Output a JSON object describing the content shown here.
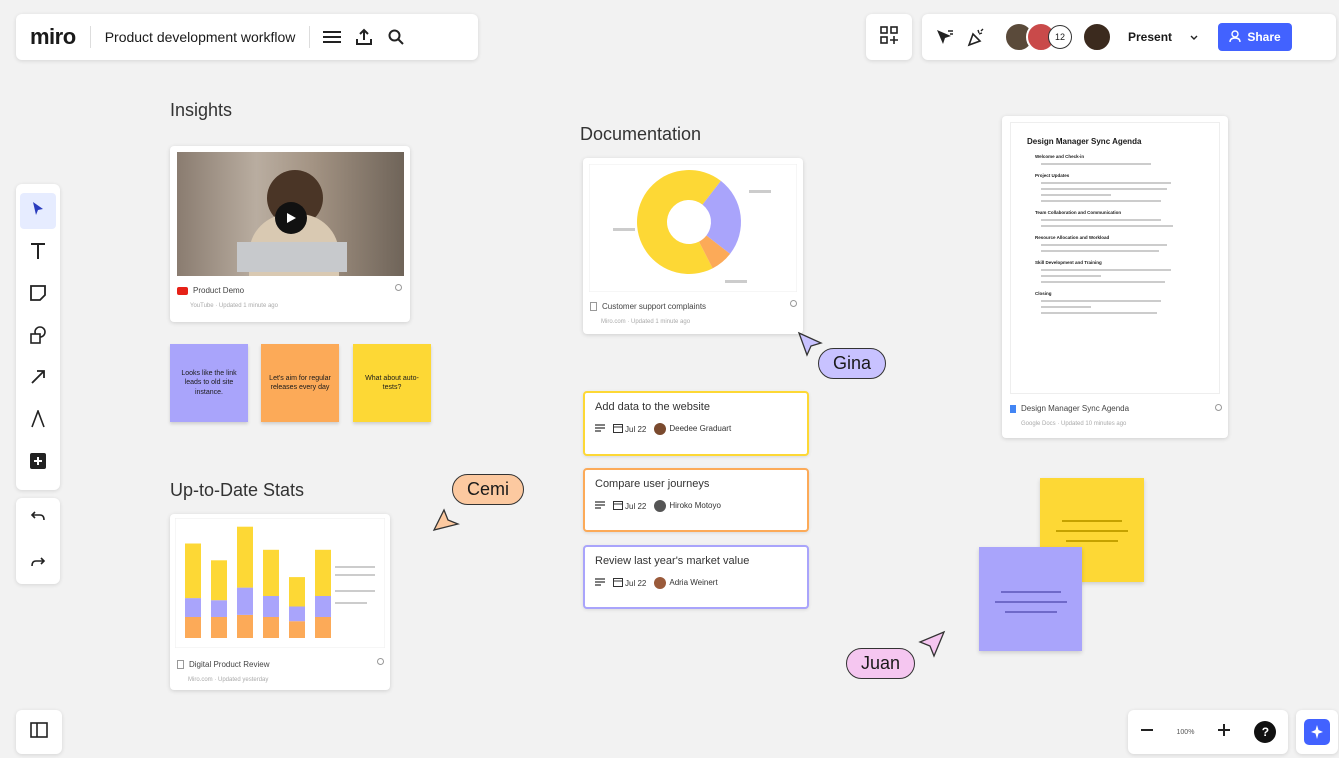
{
  "topbar": {
    "logo": "miro",
    "board_title": "Product development workflow",
    "collaborator_count": "12",
    "present_label": "Present",
    "share_label": "Share"
  },
  "colors": {
    "accent": "#4262ff",
    "sticky_purple": "#a9a4fb",
    "sticky_orange": "#fcaa58",
    "sticky_yellow": "#fdd835"
  },
  "zoom": {
    "level": "100%"
  },
  "sections": {
    "insights": "Insights",
    "stats": "Up-to-Date Stats",
    "documentation": "Documentation"
  },
  "video_card": {
    "title": "Product Demo",
    "subtitle": "YouTube · Updated 1 minute ago"
  },
  "stickies": [
    {
      "text": "Looks like the link leads to old site instance.",
      "color": "#a9a4fb"
    },
    {
      "text": "Let's aim for regular releases every day",
      "color": "#fcaa58"
    },
    {
      "text": "What about auto-tests?",
      "color": "#fdd835"
    }
  ],
  "stats_card": {
    "title": "Digital Product Review",
    "subtitle": "Miro.com · Updated yesterday"
  },
  "chart_data": [
    {
      "type": "bar",
      "stacked": true,
      "categories": [
        "1",
        "2",
        "3",
        "4",
        "5",
        "6"
      ],
      "series": [
        {
          "color": "#fcaa58",
          "values": [
            20,
            20,
            22,
            20,
            16,
            20
          ]
        },
        {
          "color": "#a9a4fb",
          "values": [
            18,
            16,
            26,
            20,
            14,
            20
          ]
        },
        {
          "color": "#fdd835",
          "values": [
            52,
            38,
            58,
            44,
            28,
            44
          ]
        }
      ]
    },
    {
      "type": "pie",
      "donut": true,
      "values": [
        68,
        25,
        7
      ],
      "colors": [
        "#fdd835",
        "#a9a4fb",
        "#fcaa58"
      ]
    }
  ],
  "doc_card": {
    "title": "Customer support complaints",
    "subtitle": "Miro.com · Updated 1 minute ago"
  },
  "tasks": [
    {
      "title": "Add data to the website",
      "date": "Jul 22",
      "assignee": "Deedee Graduart",
      "border": "#fdd835",
      "avatar": "#7a4a2e"
    },
    {
      "title": "Compare user journeys",
      "date": "Jul 22",
      "assignee": "Hiroko Motoyo",
      "border": "#fcaa58",
      "avatar": "#555555"
    },
    {
      "title": "Review last year's market value",
      "date": "Jul 22",
      "assignee": "Adria Weinert",
      "border": "#a9a4fb",
      "avatar": "#9a5a3a"
    }
  ],
  "agenda_doc": {
    "heading": "Design Manager Sync Agenda",
    "sections": [
      "Welcome and Check-in",
      "Project Updates",
      "Team Collaboration and Communication",
      "Resource Allocation and Workload",
      "Skill Development and Training",
      "Closing"
    ],
    "title": "Design Manager Sync Agenda",
    "subtitle": "Google Docs · Updated 10 minutes ago"
  },
  "cursors": [
    {
      "name": "Gina",
      "color": "#c8c2ff"
    },
    {
      "name": "Cemi",
      "color": "#fcc9a0"
    },
    {
      "name": "Juan",
      "color": "#f5c6f0"
    }
  ]
}
